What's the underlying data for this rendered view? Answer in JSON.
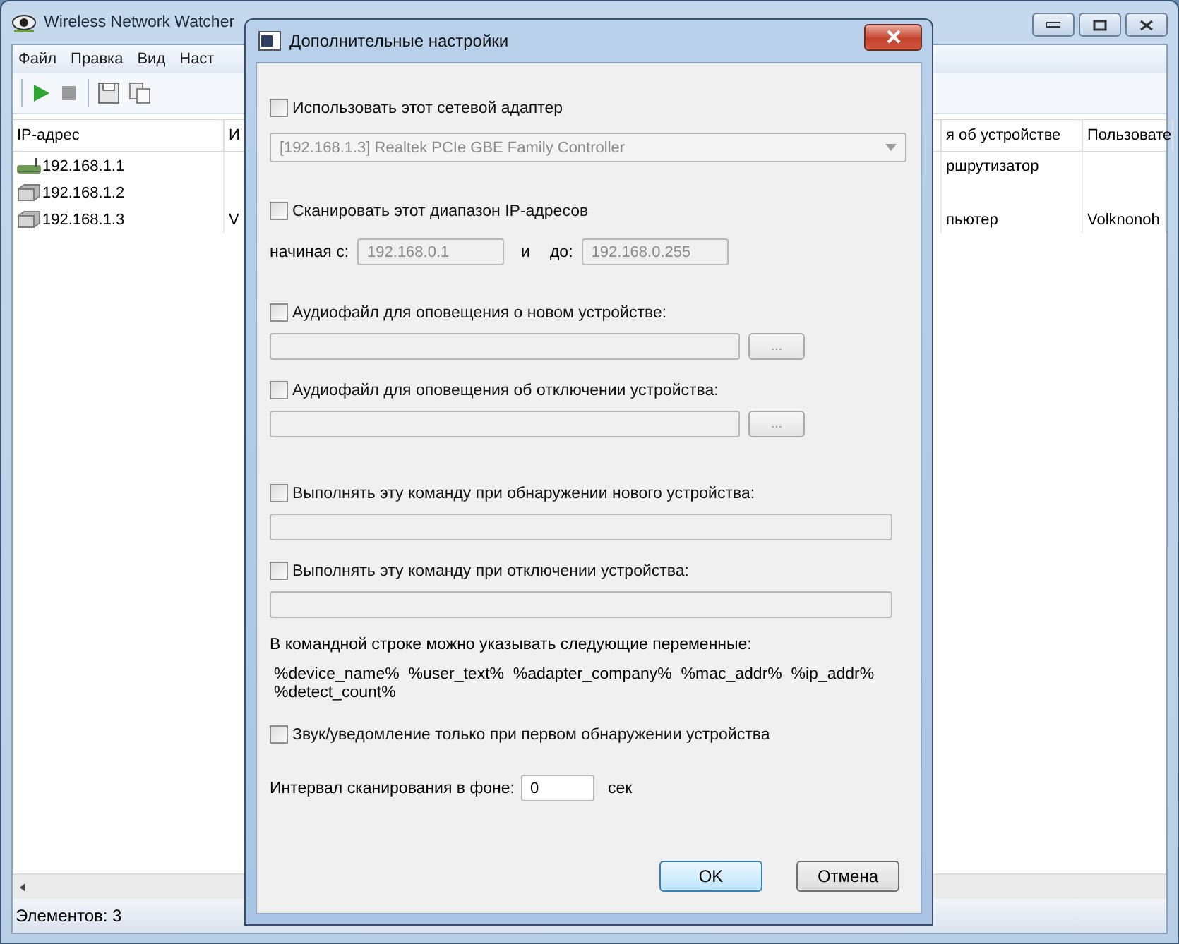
{
  "main_window": {
    "title": "Wireless Network Watcher",
    "menu": [
      "Файл",
      "Правка",
      "Вид",
      "Наст"
    ],
    "table": {
      "columns": [
        "IP-адрес",
        "И",
        "я об устройстве",
        "Пользовате"
      ],
      "rows": [
        {
          "kind": "router",
          "ip": "192.168.1.1",
          "column_3": "ршрутизатор"
        },
        {
          "kind": "computer",
          "ip": "192.168.1.2"
        },
        {
          "kind": "computer",
          "ip": "192.168.1.3",
          "column_2": "V",
          "column_3": "пьютер",
          "column_4": "Volknonoh"
        }
      ]
    },
    "status_bar": "Элементов: 3"
  },
  "dialog": {
    "title": "Дополнительные настройки",
    "use_adapter": {
      "label": "Использовать этот сетевой адаптер",
      "checked": false
    },
    "adapter_combo": {
      "value": "[192.168.1.3]  Realtek PCIe GBE Family Controller",
      "disabled": true
    },
    "scan_range": {
      "label": "Сканировать этот диапазон IP-адресов",
      "checked": false,
      "from_label": "начиная с:",
      "from_value": "192.168.0.1",
      "and_label": "и",
      "to_label": "до:",
      "to_value": "192.168.0.255",
      "disabled": true
    },
    "sound_new": {
      "label": "Аудиофайл для оповещения о новом устройстве:",
      "checked": false,
      "browse_label": "...",
      "disabled": true
    },
    "sound_off": {
      "label": "Аудиофайл для оповещения об отключении устройства:",
      "checked": false,
      "browse_label": "...",
      "disabled": true
    },
    "command_new": {
      "label": "Выполнять эту команду при обнаружении нового устройства:",
      "checked": false,
      "disabled": true
    },
    "command_off": {
      "label": "Выполнять эту команду при отключении устройства:",
      "checked": false,
      "disabled": true
    },
    "variables_note": "В командной строке можно указывать следующие переменные:",
    "variables": "%device_name%  %user_text%  %adapter_company%  %mac_addr%  %ip_addr%\n%detect_count%",
    "first_only": {
      "label": "Звук/уведомление только при первом обнаружении устройства",
      "checked": false
    },
    "interval": {
      "label": "Интервал сканирования в фоне:",
      "value": "0",
      "unit": "сек"
    },
    "buttons": [
      {
        "label": "OK",
        "default": true
      },
      {
        "label": "Отмена",
        "default": false
      }
    ]
  }
}
